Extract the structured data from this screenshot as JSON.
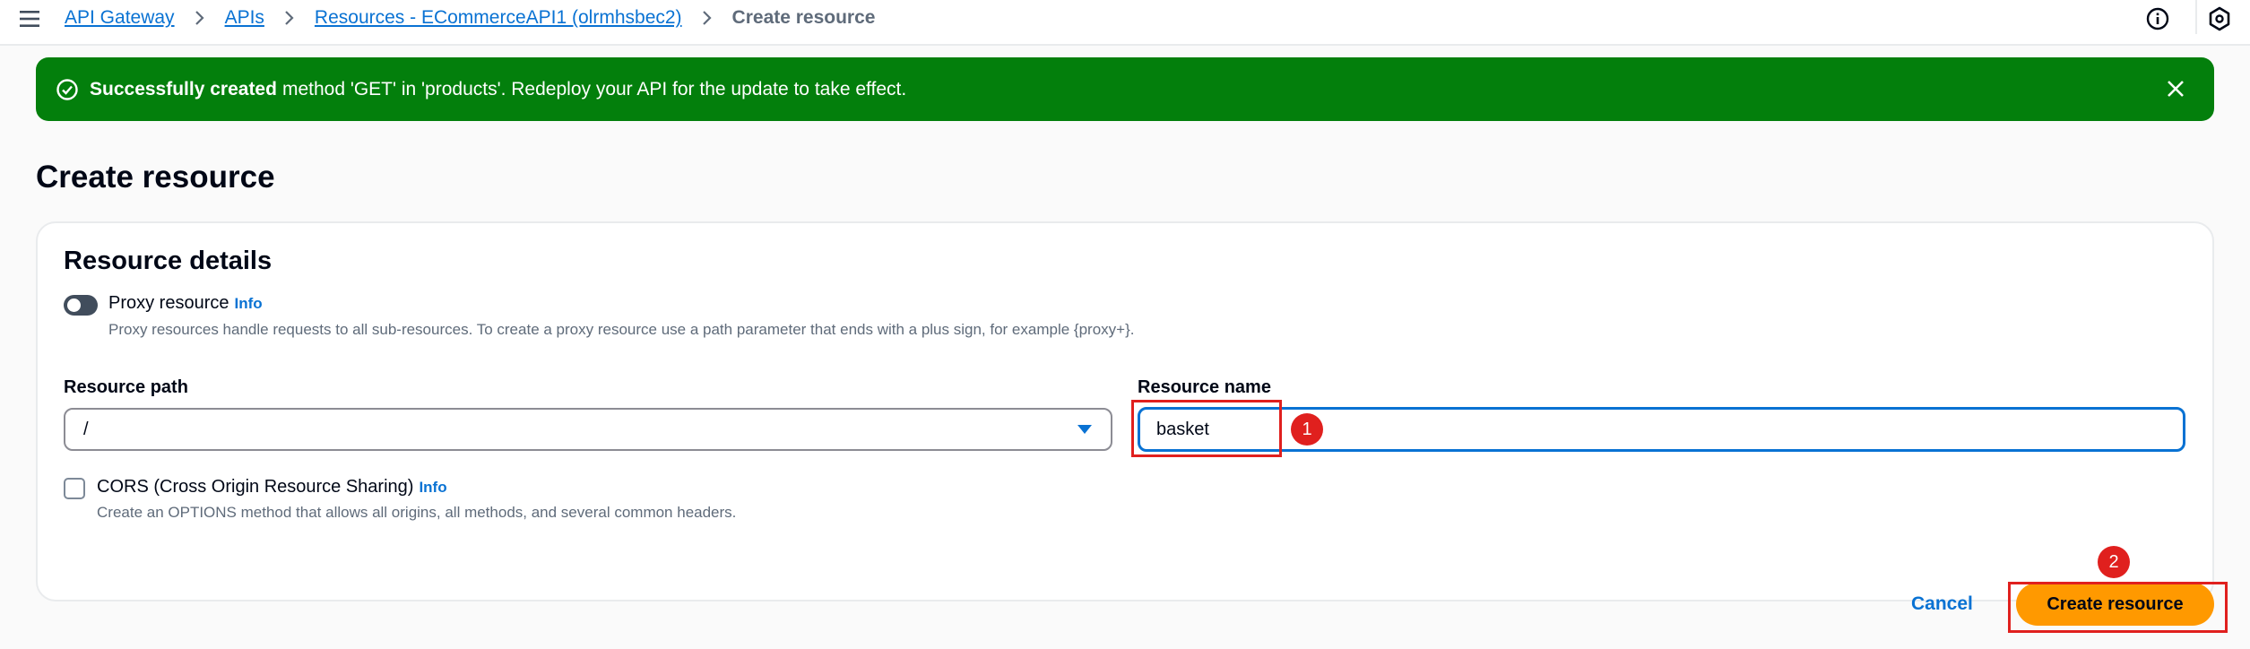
{
  "header": {
    "menu_icon": "hamburger-icon",
    "breadcrumbs": [
      "API Gateway",
      "APIs",
      "Resources - ECommerceAPI1 (olrmhsbec2)"
    ],
    "current": "Create resource",
    "info_icon": "info-icon",
    "profile_icon": "hexagon-icon"
  },
  "flash": {
    "type": "success",
    "color": "#037f0c",
    "icon": "check-circle-icon",
    "bold": "Successfully created",
    "message": "method 'GET' in 'products'. Redeploy your API for the update to take effect.",
    "dismiss_icon": "close-icon"
  },
  "page": {
    "title": "Create resource"
  },
  "form": {
    "section_title": "Resource details",
    "proxy": {
      "label": "Proxy resource",
      "info": "Info",
      "description": "Proxy resources handle requests to all sub-resources. To create a proxy resource use a path parameter that ends with a plus sign, for example {proxy+}.",
      "enabled": false
    },
    "resource_path": {
      "label": "Resource path",
      "value": "/"
    },
    "resource_name": {
      "label": "Resource name",
      "value": "basket"
    },
    "cors": {
      "label": "CORS (Cross Origin Resource Sharing)",
      "info": "Info",
      "description": "Create an OPTIONS method that allows all origins, all methods, and several common headers.",
      "checked": false
    }
  },
  "actions": {
    "cancel": "Cancel",
    "submit": "Create resource",
    "accent": "#ff9900"
  },
  "annotations": [
    "1",
    "2"
  ]
}
